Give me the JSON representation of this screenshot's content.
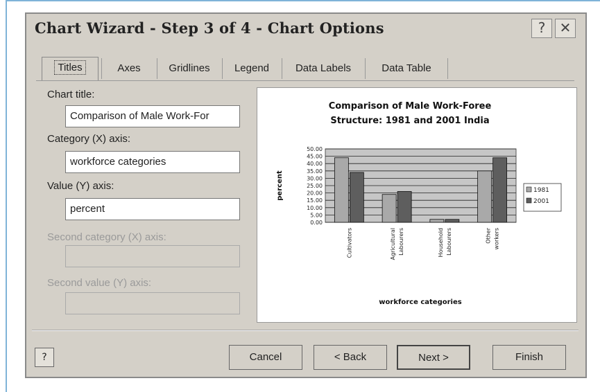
{
  "window": {
    "title": "Chart Wizard - Step 3 of 4 - Chart Options",
    "help_glyph": "?",
    "close_glyph": "✕"
  },
  "tabs": [
    {
      "label": "Titles",
      "active": true
    },
    {
      "label": "Axes",
      "active": false
    },
    {
      "label": "Gridlines",
      "active": false
    },
    {
      "label": "Legend",
      "active": false
    },
    {
      "label": "Data Labels",
      "active": false
    },
    {
      "label": "Data Table",
      "active": false
    }
  ],
  "fields": {
    "chart_title": {
      "label": "Chart title:",
      "value": "Comparison of Male Work-For"
    },
    "category_x": {
      "label": "Category (X) axis:",
      "value": "workforce categories"
    },
    "value_y": {
      "label": "Value (Y) axis:",
      "value": "percent"
    },
    "second_category_x": {
      "label": "Second category (X) axis:",
      "value": ""
    },
    "second_value_y": {
      "label": "Second value (Y) axis:",
      "value": ""
    }
  },
  "buttons": {
    "help": "?",
    "cancel": "Cancel",
    "back": "< Back",
    "next": "Next >",
    "finish": "Finish"
  },
  "chart_data": {
    "type": "bar",
    "title": "Comparison of Male Work-Foree Structure: 1981 and 2001 India",
    "title_lines": [
      "Comparison of Male Work-Foree",
      "Structure: 1981 and 2001 India"
    ],
    "xlabel": "workforce categories",
    "ylabel": "percent",
    "categories": [
      "Cultivators",
      "Agricultural Labourers",
      "Household Labourers",
      "Other workers"
    ],
    "category_lines": [
      [
        "Cultivators"
      ],
      [
        "Agricultural",
        "Labourers"
      ],
      [
        "Household",
        "Labourers"
      ],
      [
        "Other",
        "workers"
      ]
    ],
    "series": [
      {
        "name": "1981",
        "values": [
          44,
          19,
          2,
          35
        ]
      },
      {
        "name": "2001",
        "values": [
          34,
          21,
          2,
          44
        ]
      }
    ],
    "ylim": [
      0,
      50
    ],
    "yticks": [
      "0.00",
      "5.00",
      "10.00",
      "15.00",
      "20.00",
      "25.00",
      "30.00",
      "35.00",
      "40.00",
      "45.00",
      "50.00"
    ],
    "grid": true,
    "legend": "right",
    "colors": {
      "1981": "#a9a9a9",
      "2001": "#5e5e5e",
      "plot_bg": "#c6c6c6"
    }
  }
}
